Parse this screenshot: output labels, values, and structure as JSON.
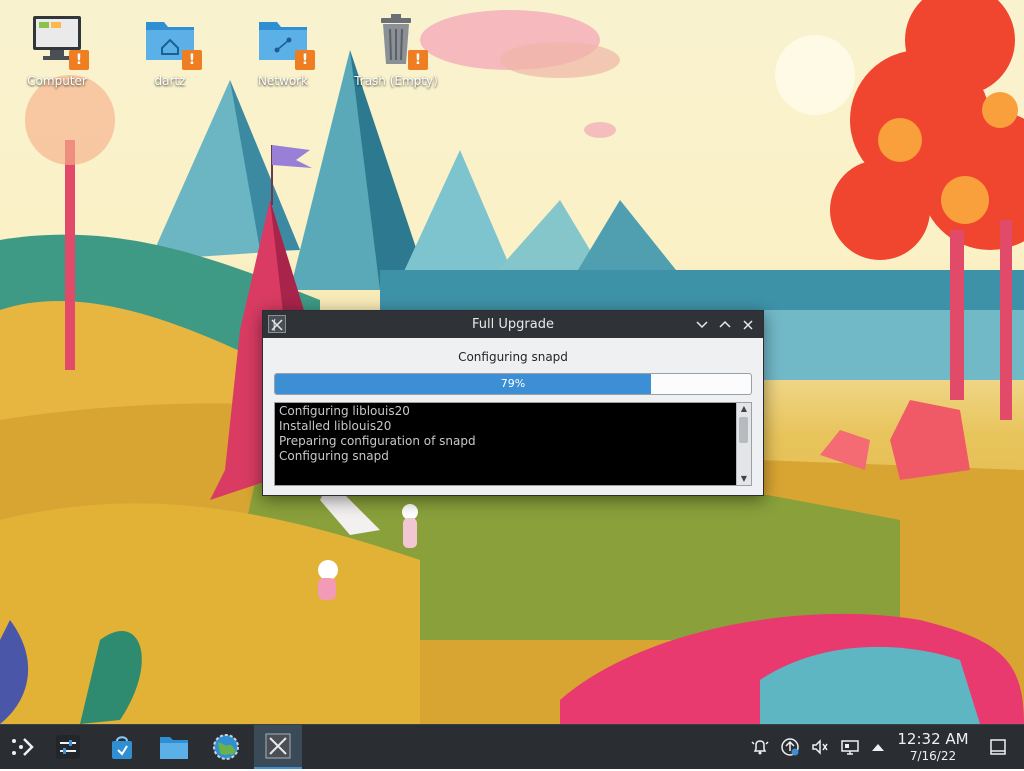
{
  "desktop": {
    "icons": [
      {
        "label": "Computer",
        "badge": "!"
      },
      {
        "label": "dartz",
        "badge": "!"
      },
      {
        "label": "Network",
        "badge": "!"
      },
      {
        "label": "Trash (Empty)",
        "badge": "!"
      }
    ]
  },
  "dialog": {
    "title": "Full Upgrade",
    "status": "Configuring snapd",
    "progress": {
      "value": 0.79,
      "label": "79%"
    },
    "log_lines": [
      "Configuring liblouis20",
      "Installed liblouis20",
      "Preparing configuration of snapd",
      "Configuring snapd"
    ]
  },
  "taskbar": {
    "clock": {
      "time": "12:32 AM",
      "date": "7/16/22"
    }
  },
  "colors": {
    "accent": "#3d8fd5",
    "warning_badge": "#ef7d22",
    "panel": "#2a2e32"
  }
}
